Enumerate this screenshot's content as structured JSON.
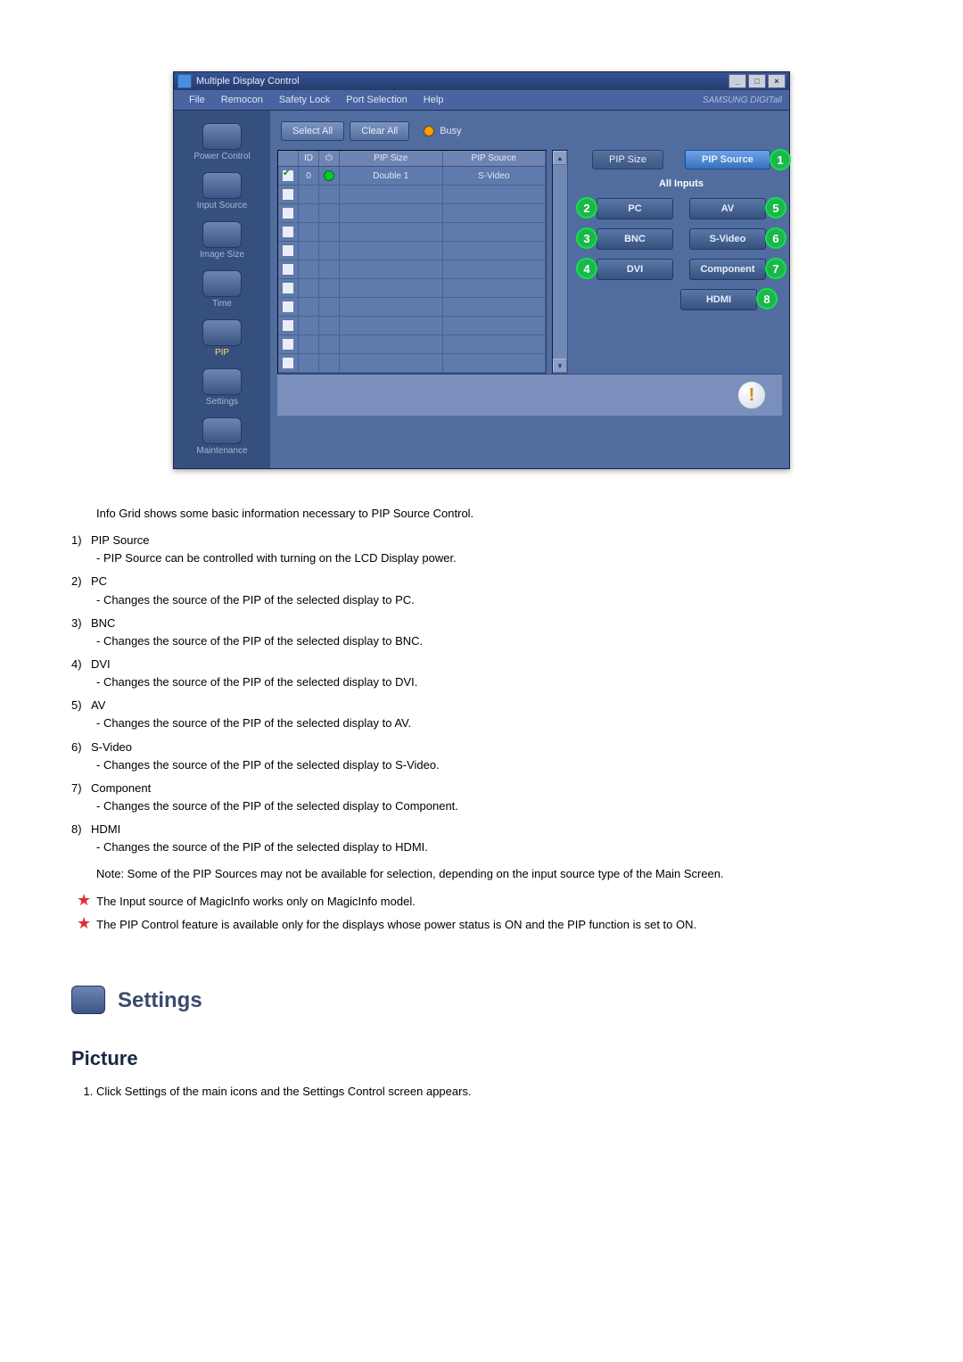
{
  "app": {
    "title": "Multiple Display Control",
    "brand": "SAMSUNG DIGITall",
    "menu": [
      "File",
      "Remocon",
      "Safety Lock",
      "Port Selection",
      "Help"
    ],
    "sidebar": [
      {
        "label": "Power Control"
      },
      {
        "label": "Input Source"
      },
      {
        "label": "Image Size"
      },
      {
        "label": "Time"
      },
      {
        "label": "PIP",
        "active": true
      },
      {
        "label": "Settings"
      },
      {
        "label": "Maintenance"
      }
    ],
    "buttons": {
      "selectAll": "Select All",
      "clearAll": "Clear All",
      "busy": "Busy"
    },
    "grid": {
      "headers": {
        "chk": "",
        "id": "ID",
        "pwr": "",
        "size": "PIP Size",
        "src": "PIP Source"
      },
      "rows": [
        {
          "checked": true,
          "id": "0",
          "power": true,
          "size": "Double 1",
          "src": "S-Video"
        },
        {
          "checked": false,
          "id": "",
          "power": false,
          "size": "",
          "src": ""
        },
        {
          "checked": false,
          "id": "",
          "power": false,
          "size": "",
          "src": ""
        },
        {
          "checked": false,
          "id": "",
          "power": false,
          "size": "",
          "src": ""
        },
        {
          "checked": false,
          "id": "",
          "power": false,
          "size": "",
          "src": ""
        },
        {
          "checked": false,
          "id": "",
          "power": false,
          "size": "",
          "src": ""
        },
        {
          "checked": false,
          "id": "",
          "power": false,
          "size": "",
          "src": ""
        },
        {
          "checked": false,
          "id": "",
          "power": false,
          "size": "",
          "src": ""
        },
        {
          "checked": false,
          "id": "",
          "power": false,
          "size": "",
          "src": ""
        },
        {
          "checked": false,
          "id": "",
          "power": false,
          "size": "",
          "src": ""
        },
        {
          "checked": false,
          "id": "",
          "power": false,
          "size": "",
          "src": ""
        }
      ]
    },
    "panel": {
      "tabs": {
        "size": "PIP Size",
        "source": "PIP Source",
        "sourceCallout": "1"
      },
      "allInputs": "All Inputs",
      "left": [
        {
          "label": "PC",
          "callout": "2"
        },
        {
          "label": "BNC",
          "callout": "3"
        },
        {
          "label": "DVI",
          "callout": "4"
        }
      ],
      "right": [
        {
          "label": "AV",
          "callout": "5"
        },
        {
          "label": "S-Video",
          "callout": "6"
        },
        {
          "label": "Component",
          "callout": "7"
        },
        {
          "label": "HDMI",
          "callout": "8"
        }
      ]
    }
  },
  "doc": {
    "intro": "Info Grid shows some basic information necessary to PIP Source Control.",
    "items": [
      {
        "n": "1)",
        "t": "PIP Source",
        "d": "- PIP Source can be controlled with turning on the LCD Display power."
      },
      {
        "n": "2)",
        "t": "PC",
        "d": "- Changes the source of the PIP of the selected display to PC."
      },
      {
        "n": "3)",
        "t": "BNC",
        "d": "- Changes the source of the PIP of the selected display to BNC."
      },
      {
        "n": "4)",
        "t": "DVI",
        "d": "- Changes the source of the PIP of the selected display to DVI."
      },
      {
        "n": "5)",
        "t": "AV",
        "d": "- Changes the source of the PIP of the selected display to AV."
      },
      {
        "n": "6)",
        "t": "S-Video",
        "d": "- Changes the source of the PIP of the selected display to S-Video."
      },
      {
        "n": "7)",
        "t": "Component",
        "d": "- Changes the source of the PIP of the selected display to Component."
      },
      {
        "n": "8)",
        "t": "HDMI",
        "d": "- Changes the source of the PIP of the selected display to HDMI."
      }
    ],
    "note": "Note: Some of the PIP Sources may not be available for selection, depending on the input source type of the Main Screen.",
    "star1": "The Input source of MagicInfo works only on MagicInfo model.",
    "star2": "The PIP Control feature is available only for the displays whose power status is ON and the PIP function is set to ON.",
    "settingsHeading": "Settings",
    "pictureHeading": "Picture",
    "step1": "Click Settings of the main icons and the Settings Control screen appears."
  }
}
